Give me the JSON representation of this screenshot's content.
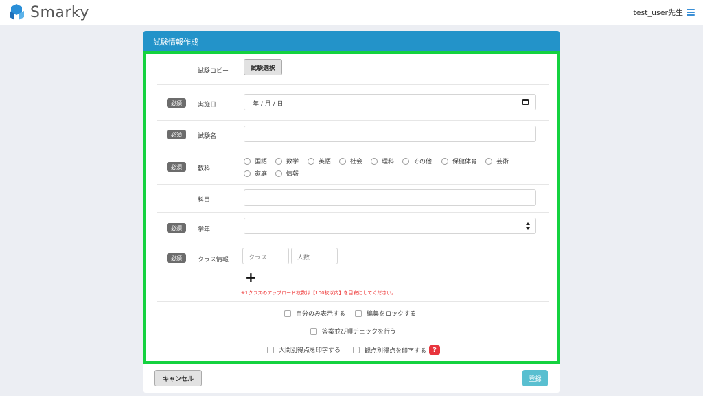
{
  "app": {
    "logo_text": "Smarky"
  },
  "header": {
    "user_label": "test_user先生"
  },
  "form": {
    "title": "試験情報作成",
    "required_badge": "必須",
    "copy": {
      "label": "試験コピー",
      "button": "試験選択"
    },
    "date": {
      "label": "実施日",
      "value": "年 / 月 / 日"
    },
    "exam_name": {
      "label": "試験名",
      "value": ""
    },
    "subject": {
      "label": "教科",
      "options": [
        "国語",
        "数学",
        "英語",
        "社会",
        "理科",
        "その他",
        "保健体育",
        "芸術",
        "家庭",
        "情報"
      ]
    },
    "course": {
      "label": "科目",
      "value": ""
    },
    "grade": {
      "label": "学年",
      "selected": ""
    },
    "class_info": {
      "label": "クラス情報",
      "class_placeholder": "クラス",
      "count_placeholder": "人数",
      "add_symbol": "+",
      "note": "※1クラスのアップロード枚数は【100枚以内】を目安にしてください。"
    },
    "checks": {
      "self_only": "自分のみ表示する",
      "lock_edit": "編集をロックする",
      "order_check": "答案並び順チェックを行う",
      "print_question_scores": "大問別得点を印字する",
      "print_viewpoint_scores": "観点別得点を印字する",
      "help_symbol": "?"
    }
  },
  "footer": {
    "cancel": "キャンセル",
    "register": "登録"
  },
  "colors": {
    "header_blue": "#2393c9",
    "highlight_green": "#14d23f",
    "register_teal": "#59bfd0",
    "help_red": "#e8343d"
  },
  "icons": [
    "logo-icon",
    "menu-icon",
    "calendar-icon",
    "select-arrow-icon",
    "add-icon",
    "help-icon"
  ]
}
